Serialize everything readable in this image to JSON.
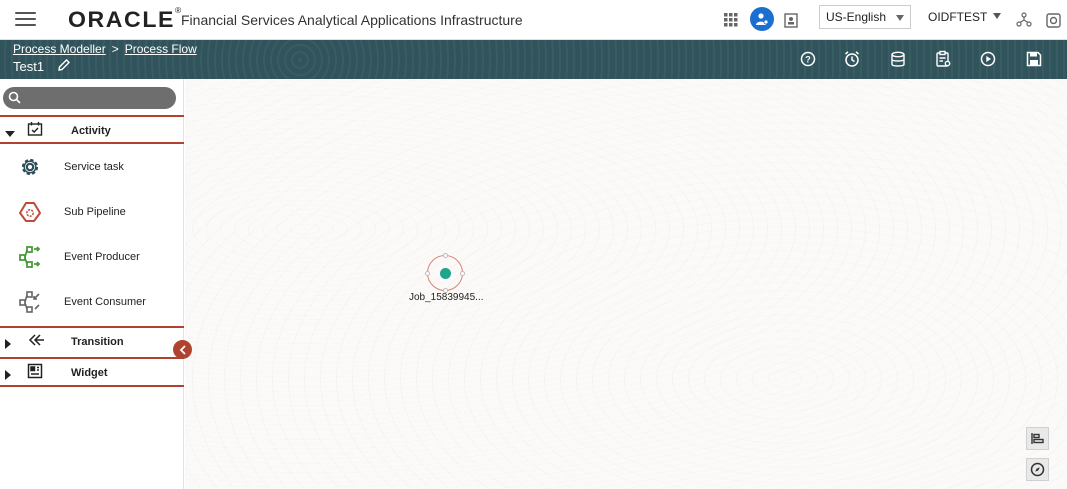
{
  "header": {
    "logo_text": "ORACLE",
    "app_title": "Financial Services Analytical Applications Infrastructure",
    "language": "US-English",
    "user": "OIDFTEST"
  },
  "subheader": {
    "breadcrumb": [
      "Process Modeller",
      ">",
      "Process Flow"
    ],
    "flow_name": "Test1"
  },
  "sidebar": {
    "search_placeholder": "",
    "sections": [
      {
        "label": "Activity",
        "expanded": true,
        "items": [
          {
            "label": "Service task",
            "icon": "gear-icon"
          },
          {
            "label": "Sub Pipeline",
            "icon": "sub-pipeline-icon"
          },
          {
            "label": "Event Producer",
            "icon": "event-producer-icon"
          },
          {
            "label": "Event Consumer",
            "icon": "event-consumer-icon"
          }
        ]
      },
      {
        "label": "Transition",
        "expanded": false
      },
      {
        "label": "Widget",
        "expanded": false
      }
    ]
  },
  "canvas": {
    "node_label": "Job_15839945..."
  },
  "colors": {
    "accent": "#b0432f",
    "subheader_bg": "#31545c",
    "node_fill": "#1fa58a",
    "user_badge": "#1a6fd1"
  }
}
